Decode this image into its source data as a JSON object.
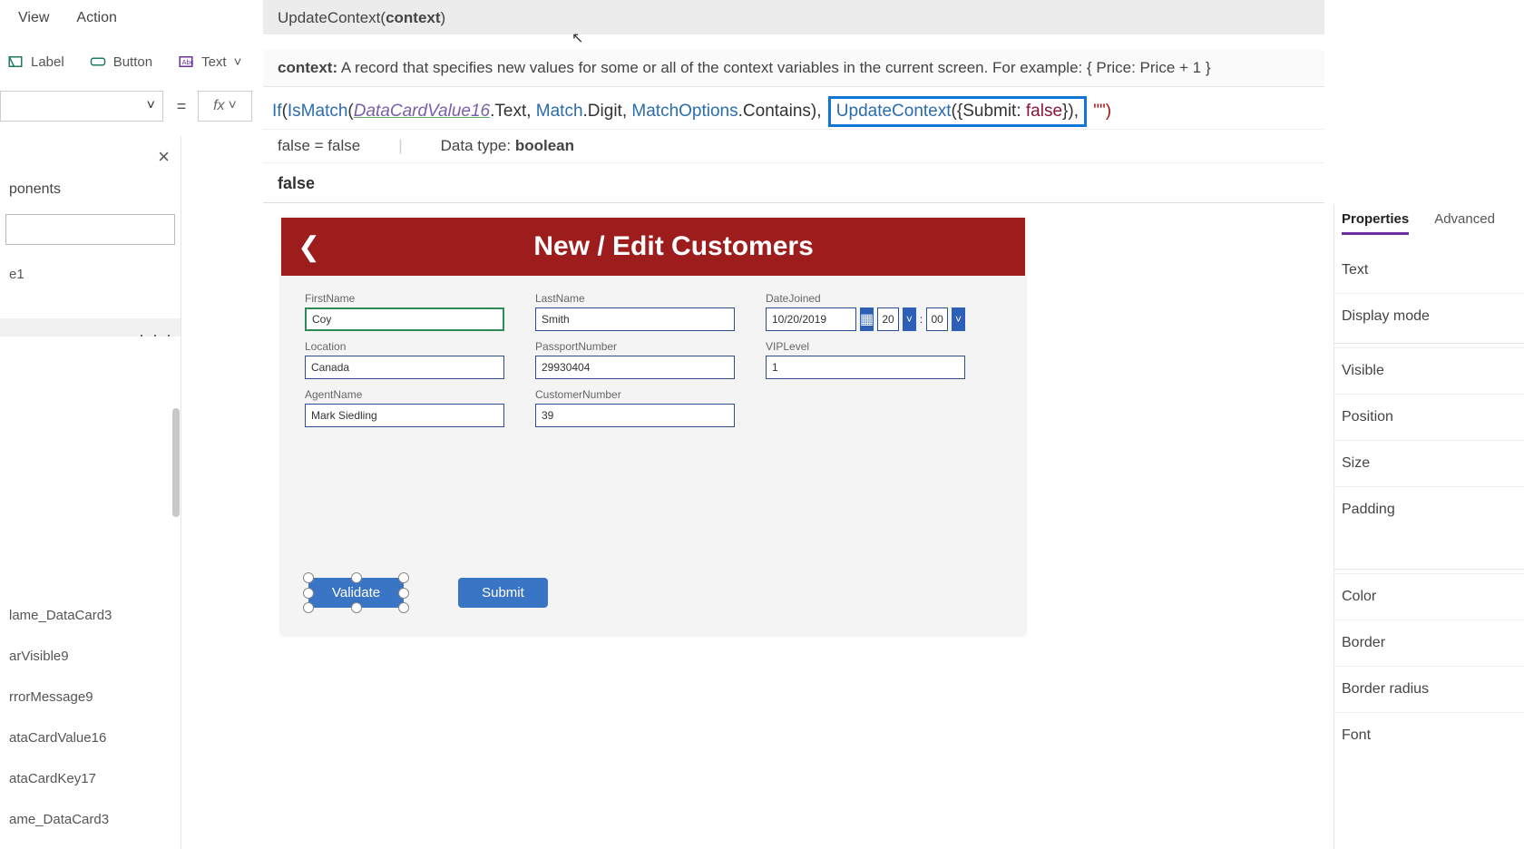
{
  "menu": {
    "view": "View",
    "action": "Action"
  },
  "ribbon": {
    "label": "Label",
    "button": "Button",
    "text": "Text"
  },
  "tooltip": {
    "signature": "UpdateContext(context)",
    "help_prefix": "context:",
    "help_body": " A record that specifies new values for some or all of the context variables in the current screen. For example: { Price: Price + 1 }"
  },
  "formula": {
    "if": "If",
    "ismatch": "IsMatch",
    "dcv": "DataCardValue16",
    "text": ".Text, ",
    "match": "Match",
    "digit": ".Digit, ",
    "matchopts": "MatchOptions",
    "contains": ".Contains), ",
    "updatectx": "UpdateContext",
    "record": "({Submit: ",
    "false": "false",
    "record_end": "}),",
    "tail": " \"\")"
  },
  "evalrow": {
    "lhs": "false  =  false",
    "dt_label": "Data type: ",
    "dt_value": "boolean"
  },
  "result": "false",
  "tree": {
    "tab": "ponents",
    "item_e1": "e1",
    "dots": "· · ·",
    "n1": "lame_DataCard3",
    "n2": "arVisible9",
    "n3": "rrorMessage9",
    "n4": "ataCardValue16",
    "n5": "ataCardKey17",
    "n6": "ame_DataCard3"
  },
  "form": {
    "title": "New / Edit Customers",
    "firstname_l": "FirstName",
    "firstname_v": "Coy",
    "lastname_l": "LastName",
    "lastname_v": "Smith",
    "datejoined_l": "DateJoined",
    "datejoined_v": "10/20/2019",
    "hour": "20",
    "minute": "00",
    "location_l": "Location",
    "location_v": "Canada",
    "passport_l": "PassportNumber",
    "passport_v": "29930404",
    "vip_l": "VIPLevel",
    "vip_v": "1",
    "agent_l": "AgentName",
    "agent_v": "Mark Siedling",
    "custnum_l": "CustomerNumber",
    "custnum_v": "39",
    "validate": "Validate",
    "submit": "Submit"
  },
  "props": {
    "tab_props": "Properties",
    "tab_adv": "Advanced",
    "text": "Text",
    "display": "Display mode",
    "visible": "Visible",
    "position": "Position",
    "size": "Size",
    "padding": "Padding",
    "color": "Color",
    "border": "Border",
    "radius": "Border radius",
    "font": "Font"
  }
}
